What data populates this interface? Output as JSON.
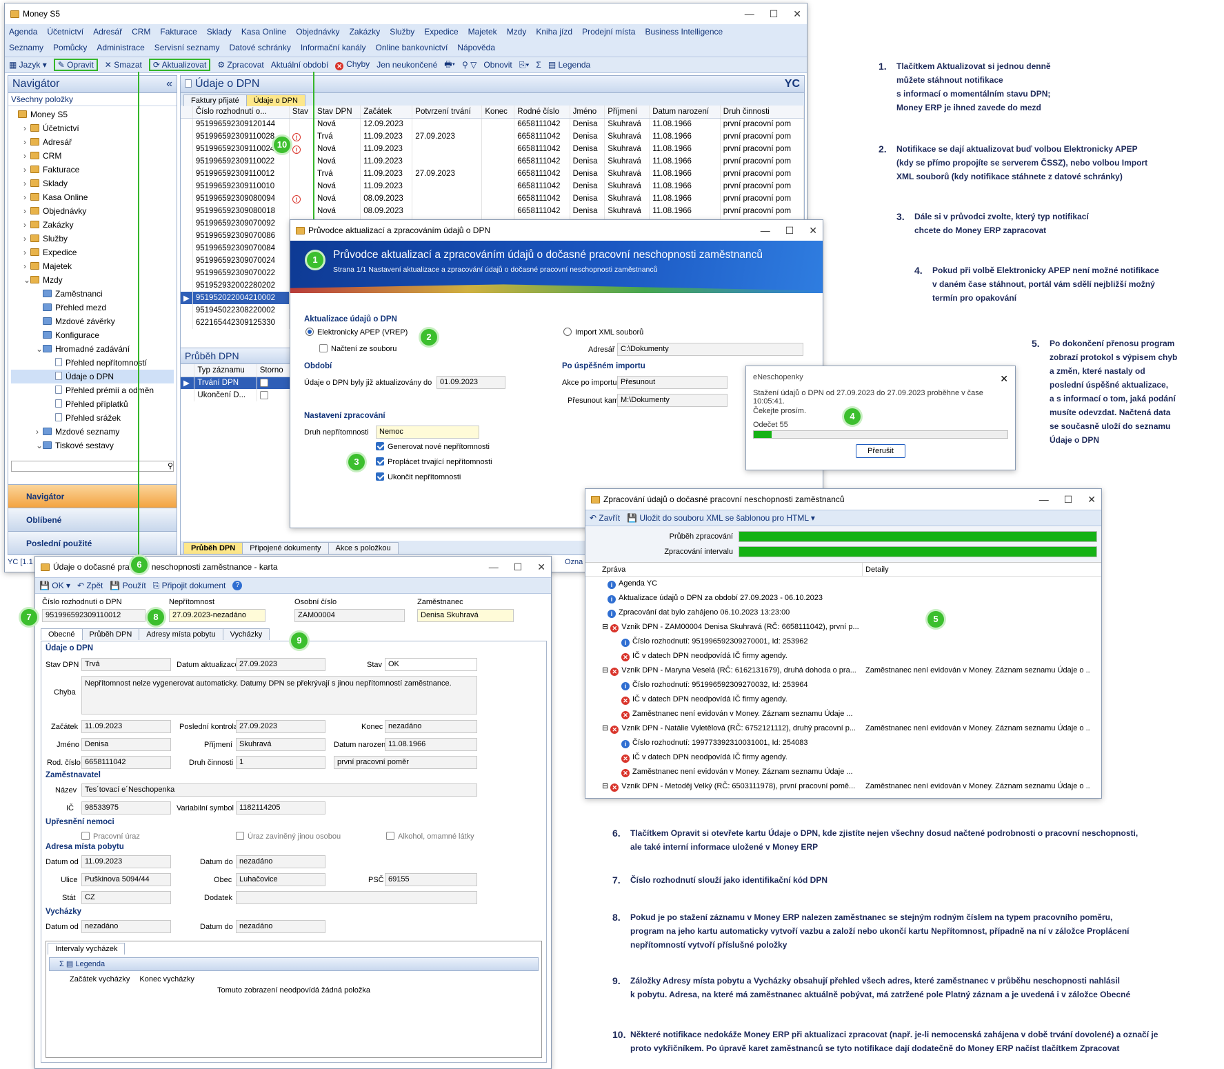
{
  "main": {
    "title": "Money S5",
    "menu1": [
      "Agenda",
      "Účetnictví",
      "Adresář",
      "CRM",
      "Fakturace",
      "Sklady",
      "Kasa Online",
      "Objednávky",
      "Zakázky",
      "Služby",
      "Expedice",
      "Majetek",
      "Mzdy",
      "Kniha jízd",
      "Prodejní místa",
      "Business Intelligence"
    ],
    "menu2": [
      "Seznamy",
      "Pomůcky",
      "Administrace",
      "Servisní seznamy",
      "Datové schránky",
      "Informační kanály",
      "Online bankovnictví",
      "Nápověda"
    ],
    "toolbar": {
      "jazyk": "Jazyk",
      "opravit": "Opravit",
      "smazat": "Smazat",
      "aktualizovat": "Aktualizovat",
      "zpracovat": "Zpracovat",
      "obdobi": "Aktuální období",
      "chyby": "Chyby",
      "neukoncene": "Jen neukončené",
      "obnovit": "Obnovit",
      "legenda": "Legenda"
    },
    "navigator": {
      "title": "Navigátor",
      "all": "Všechny položky",
      "items": [
        "Money S5",
        "Účetnictví",
        "Adresář",
        "CRM",
        "Fakturace",
        "Sklady",
        "Kasa Online",
        "Objednávky",
        "Zakázky",
        "Služby",
        "Expedice",
        "Majetek",
        "Mzdy",
        "Zaměstnanci",
        "Přehled mezd",
        "Mzdové závěrky",
        "Konfigurace",
        "Hromadné zadávání",
        "Přehled nepřítomností",
        "Údaje o DPN",
        "Přehled prémií a odměn",
        "Přehled příplatků",
        "Přehled srážek",
        "Mzdové seznamy",
        "Tiskové sestavy"
      ],
      "bottom": [
        "Navigátor",
        "Oblíbené",
        "Poslední použité"
      ]
    },
    "content_title": "Údaje o DPN",
    "yc": "YC",
    "tabs": [
      "Faktury přijaté",
      "Údaje o DPN"
    ],
    "columns": [
      "Číslo rozhodnutí o...",
      "Stav",
      "Stav DPN",
      "Začátek",
      "Potvrzení trvání",
      "Konec",
      "Rodné číslo",
      "Jméno",
      "Příjmení",
      "Datum narození",
      "Druh činnosti"
    ],
    "rows": [
      [
        "951996592309120144",
        "",
        "Nová",
        "12.09.2023",
        "",
        "",
        "6658111042",
        "Denisa",
        "Skuhravá",
        "11.08.1966",
        "první pracovní pom"
      ],
      [
        "951996592309110028",
        "!",
        "Trvá",
        "11.09.2023",
        "27.09.2023",
        "",
        "6658111042",
        "Denisa",
        "Skuhravá",
        "11.08.1966",
        "první pracovní pom"
      ],
      [
        "951996592309110024",
        "!",
        "Nová",
        "11.09.2023",
        "",
        "",
        "6658111042",
        "Denisa",
        "Skuhravá",
        "11.08.1966",
        "první pracovní pom"
      ],
      [
        "951996592309110022",
        "",
        "Nová",
        "11.09.2023",
        "",
        "",
        "6658111042",
        "Denisa",
        "Skuhravá",
        "11.08.1966",
        "první pracovní pom"
      ],
      [
        "951996592309110012",
        "",
        "Trvá",
        "11.09.2023",
        "27.09.2023",
        "",
        "6658111042",
        "Denisa",
        "Skuhravá",
        "11.08.1966",
        "první pracovní pom"
      ],
      [
        "951996592309110010",
        "",
        "Nová",
        "11.09.2023",
        "",
        "",
        "6658111042",
        "Denisa",
        "Skuhravá",
        "11.08.1966",
        "první pracovní pom"
      ],
      [
        "951996592309080094",
        "!",
        "Nová",
        "08.09.2023",
        "",
        "",
        "6658111042",
        "Denisa",
        "Skuhravá",
        "11.08.1966",
        "první pracovní pom"
      ],
      [
        "951996592309080018",
        "",
        "Nová",
        "08.09.2023",
        "",
        "",
        "6658111042",
        "Denisa",
        "Skuhravá",
        "11.08.1966",
        "první pracovní pom"
      ],
      [
        "951996592309070092",
        "",
        "",
        "",
        "",
        "",
        "",
        "",
        "",
        "",
        ""
      ],
      [
        "951996592309070086",
        "",
        "",
        "",
        "",
        "",
        "",
        "",
        "",
        "",
        ""
      ],
      [
        "951996592309070084",
        "",
        "",
        "",
        "",
        "",
        "",
        "",
        "",
        "",
        ""
      ],
      [
        "951996592309070024",
        "",
        "",
        "",
        "",
        "",
        "",
        "",
        "",
        "",
        ""
      ],
      [
        "951996592309070022",
        "",
        "",
        "",
        "",
        "",
        "",
        "",
        "",
        "",
        ""
      ],
      [
        "951952932002280202",
        "",
        "",
        "",
        "",
        "",
        "",
        "",
        "",
        "",
        ""
      ],
      [
        "951952022004210002",
        "",
        "",
        "",
        "",
        "",
        "",
        "",
        "",
        "",
        ""
      ],
      [
        "951945022308220002",
        "",
        "",
        "",
        "",
        "",
        "",
        "",
        "",
        "",
        ""
      ],
      [
        "622165442309125330",
        "",
        "",
        "",
        "",
        "",
        "",
        "",
        "",
        "",
        ""
      ]
    ],
    "prubeh_title": "Průběh DPN",
    "prubeh_cols": [
      "Typ záznamu",
      "Storno"
    ],
    "prubeh_rows": [
      "Trvání DPN",
      "Ukončení D..."
    ],
    "bottom_tabs": [
      "Průběh DPN",
      "Připojené dokumenty",
      "Akce s položkou"
    ],
    "status": "YC [1.1",
    "status2": "Ozna"
  },
  "wizard": {
    "title": "Průvodce aktualizací a zpracováním údajů o DPN",
    "banner_title": "Průvodce aktualizací a zpracováním údajů o dočasné pracovní neschopnosti zaměstnanců",
    "banner_sub": "Strana 1/1 Nastavení aktualizace a zpracování údajů o dočasné pracovní neschopnosti zaměstnanců",
    "s_aktual": "Aktualizace údajů o DPN",
    "apep": "Elektronicky APEP (VREP)",
    "xml": "Import XML souborů",
    "nacteni": "Načtení ze souboru",
    "adresar_lbl": "Adresář",
    "adresar_val": "C:\\Dokumenty",
    "s_obdobi": "Období",
    "obdobi_lbl": "Údaje o DPN byly již aktualizovány do",
    "obdobi_val": "01.09.2023",
    "s_import": "Po úspěšném importu",
    "akce_lbl": "Akce po importu",
    "akce_val": "Přesunout",
    "presun_lbl": "Přesunout kam",
    "presun_val": "M:\\Dokumenty",
    "s_nast": "Nastavení zpracování",
    "druh_lbl": "Druh nepřítomnosti",
    "druh_val": "Nemoc",
    "c1": "Generovat nové nepřítomnosti",
    "c2": "Proplácet trvající nepřítomnosti",
    "c3": "Ukončit nepřítomnosti"
  },
  "enesch": {
    "title": "eNeschopenky",
    "msg1": "Stažení údajů o DPN od 27.09.2023 do 27.09.2023 proběhne v čase 10:05:41.",
    "msg2": "Čekejte prosím.",
    "odecet": "Odečet 55",
    "progress": 0.07,
    "btn": "Přerušit"
  },
  "zprac": {
    "title": "Zpracování údajů o dočasné pracovní neschopnosti zaměstnanců",
    "zavrit": "Zavřít",
    "ulozit": "Uložit do souboru XML se šablonou pro HTML",
    "p1": "Průběh zpracování",
    "p2": "Zpracování intervalu",
    "col1": "Zpráva",
    "col2": "Detaily",
    "rows": [
      {
        "t": "info",
        "lvl": 1,
        "m": "Agenda YC",
        "d": ""
      },
      {
        "t": "info",
        "lvl": 1,
        "m": "Aktualizace údajů o DPN za období 27.09.2023 - 06.10.2023",
        "d": ""
      },
      {
        "t": "info",
        "lvl": 1,
        "m": "Zpracování dat bylo zahájeno 06.10.2023 13:23:00",
        "d": ""
      },
      {
        "t": "err",
        "lvl": 0,
        "m": "Vznik DPN - ZAM00004 Denisa Skuhravá (RČ: 6658111042), první p...",
        "d": ""
      },
      {
        "t": "info",
        "lvl": 2,
        "m": "Číslo rozhodnutí: 951996592309270001, Id: 253962",
        "d": ""
      },
      {
        "t": "err",
        "lvl": 2,
        "m": "IČ v datech DPN neodpovídá IČ firmy agendy.",
        "d": ""
      },
      {
        "t": "err",
        "lvl": 0,
        "m": "Vznik DPN - Maryna Veselá (RČ: 6162131679), druhá dohoda o pra...",
        "d": "Zaměstnanec není evidován v Money. Záznam seznamu Údaje o ..."
      },
      {
        "t": "info",
        "lvl": 2,
        "m": "Číslo rozhodnutí: 951996592309270032, Id: 253964",
        "d": ""
      },
      {
        "t": "err",
        "lvl": 2,
        "m": "IČ v datech DPN neodpovídá IČ firmy agendy.",
        "d": ""
      },
      {
        "t": "err",
        "lvl": 2,
        "m": "Zaměstnanec není evidován v Money. Záznam seznamu Údaje ...",
        "d": ""
      },
      {
        "t": "err",
        "lvl": 0,
        "m": "Vznik DPN - Natálie Vyletělová (RČ: 6752121112), druhý pracovní p...",
        "d": "Zaměstnanec není evidován v Money. Záznam seznamu Údaje o ..."
      },
      {
        "t": "info",
        "lvl": 2,
        "m": "Číslo rozhodnutí: 199773392310031001, Id: 254083",
        "d": ""
      },
      {
        "t": "err",
        "lvl": 2,
        "m": "IČ v datech DPN neodpovídá IČ firmy agendy.",
        "d": ""
      },
      {
        "t": "err",
        "lvl": 2,
        "m": "Zaměstnanec není evidován v Money. Záznam seznamu Údaje ...",
        "d": ""
      },
      {
        "t": "err",
        "lvl": 0,
        "m": "Vznik DPN - Metoděj Velký (RČ: 6503111978), první pracovní pomě...",
        "d": "Zaměstnanec není evidován v Money. Záznam seznamu Údaje o ..."
      }
    ]
  },
  "karta": {
    "title": "Údaje o dočasné pracovní neschopnosti zaměstnance - karta",
    "ok": "OK",
    "zpet": "Zpět",
    "pouzit": "Použít",
    "pripojit": "Připojit dokument",
    "cislo_lbl": "Číslo rozhodnutí o DPN",
    "cislo_val": "951996592309110012",
    "nep_lbl": "Nepřítomnost",
    "nep_val": "27.09.2023-nezadáno",
    "os_lbl": "Osobní číslo",
    "os_val": "ZAM00004",
    "zam_lbl": "Zaměstnanec",
    "zam_val": "Denisa Skuhravá",
    "tabs": [
      "Obecné",
      "Průběh DPN",
      "Adresy místa pobytu",
      "Vycházky"
    ],
    "s1": "Údaje o DPN",
    "stavdpn_lbl": "Stav DPN",
    "stavdpn_val": "Trvá",
    "datakt_lbl": "Datum aktualizace",
    "datakt_val": "27.09.2023",
    "stav_lbl": "Stav",
    "stav_val": "OK",
    "chyba_lbl": "Chyba",
    "chyba_val": "Nepřítomnost nelze vygenerovat automaticky. Datumy DPN se překrývají s jinou nepřítomností zaměstnance.",
    "zac_lbl": "Začátek",
    "zac_val": "11.09.2023",
    "posl_lbl": "Poslední kontrola",
    "posl_val": "27.09.2023",
    "kon_lbl": "Konec",
    "kon_val": "nezadáno",
    "jm_lbl": "Jméno",
    "jm_val": "Denisa",
    "pr_lbl": "Příjmení",
    "pr_val": "Skuhravá",
    "dn_lbl": "Datum narození",
    "dn_val": "11.08.1966",
    "rc_lbl": "Rod. číslo",
    "rc_val": "6658111042",
    "dc_lbl": "Druh činnosti",
    "dc_val": "1",
    "dc_txt": "první pracovní poměr",
    "s2": "Zaměstnavatel",
    "naz_lbl": "Název",
    "naz_val": "Tes´tovací e´Neschopenka",
    "ic_lbl": "IČ",
    "ic_val": "98533975",
    "vs_lbl": "Variabilní symbol",
    "vs_val": "1182114205",
    "s3": "Upřesnění nemoci",
    "u1": "Pracovní úraz",
    "u2": "Úraz zaviněný jinou osobou",
    "u3": "Alkohol, omamné látky",
    "s4": "Adresa místa pobytu",
    "dod_lbl": "Datum od",
    "dod_val": "11.09.2023",
    "ddo_lbl": "Datum do",
    "ddo_val": "nezadáno",
    "ul_lbl": "Ulice",
    "ul_val": "Puškinova 5094/44",
    "ob_lbl": "Obec",
    "ob_val": "Luhačovice",
    "psc_lbl": "PSČ",
    "psc_val": "69155",
    "st_lbl": "Stát",
    "st_val": "CZ",
    "dodat_lbl": "Dodatek",
    "s5": "Vycházky",
    "vod_lbl": "Datum od",
    "vod_val": "nezadáno",
    "vdo_lbl": "Datum do",
    "vdo_val": "nezadáno",
    "int_tab": "Intervaly vycházek",
    "legenda": "Legenda",
    "vc1": "Začátek vycházky",
    "vc2": "Konec vycházky",
    "empty": "Tomuto zobrazení neodpovídá žádná položka"
  },
  "notes": [
    {
      "n": "1.",
      "t": "Tlačítkem Aktualizovat si jednou denně\nmůžete stáhnout notifikace\ns informací o momentálním stavu DPN;\nMoney ERP je ihned zavede do mezd"
    },
    {
      "n": "2.",
      "t": "Notifikace se dají aktualizovat buď volbou Elektronicky APEP\n(kdy se přímo propojíte se serverem ČSSZ), nebo volbou Import\nXML souborů (kdy notifikace stáhnete z datové schránky)"
    },
    {
      "n": "3.",
      "t": "Dále si v průvodci zvolte, který typ notifikací\nchcete do Money ERP zapracovat"
    },
    {
      "n": "4.",
      "t": "Pokud při volbě Elektronicky APEP není možné notifikace\nv daném čase stáhnout, portál vám sdělí nejbližší možný\ntermín pro opakování"
    },
    {
      "n": "5.",
      "t": "Po dokončení přenosu program\nzobrazí protokol s výpisem chyb\na změn, které nastaly od\nposlední úspěšné aktualizace,\na s informací o tom, jaká podání\nmusíte odevzdat. Načtená data\nse současně uloží do seznamu\nÚdaje o DPN"
    },
    {
      "n": "6.",
      "t": "Tlačítkem Opravit si otevřete kartu Údaje o DPN, kde zjistíte nejen všechny dosud načtené podrobnosti o pracovní neschopnosti,\nale také interní informace uložené v Money ERP"
    },
    {
      "n": "7.",
      "t": "Číslo rozhodnutí slouží jako identifikační kód DPN"
    },
    {
      "n": "8.",
      "t": "Pokud je po stažení záznamu v Money ERP nalezen zaměstnanec se stejným rodným číslem na typem pracovního poměru,\nprogram na jeho kartu automaticky vytvoří vazbu a založí nebo ukončí kartu Nepřítomnost, případně na ní v záložce Proplácení\nnepřítomností vytvoří příslušné položky"
    },
    {
      "n": "9.",
      "t": "Záložky Adresy místa pobytu a Vycházky obsahují přehled všech adres, které zaměstnanec v průběhu neschopnosti nahlásil\nk pobytu. Adresa, na které má zaměstnanec aktuálně pobývat, má zatržené pole Platný záznam a je uvedená i v záložce Obecné"
    },
    {
      "n": "10.",
      "t": "Některé notifikace nedokáže Money ERP při aktualizaci zpracovat (např. je-li nemocenská zahájena v době trvání dovolené) a označí je\nproto vykřičníkem. Po úpravě karet zaměstnanců se tyto notifikace dají dodatečně do Money ERP načíst tlačítkem Zpracovat"
    }
  ],
  "badges": [
    "1",
    "2",
    "3",
    "4",
    "5",
    "6",
    "7",
    "8",
    "9",
    "10"
  ]
}
